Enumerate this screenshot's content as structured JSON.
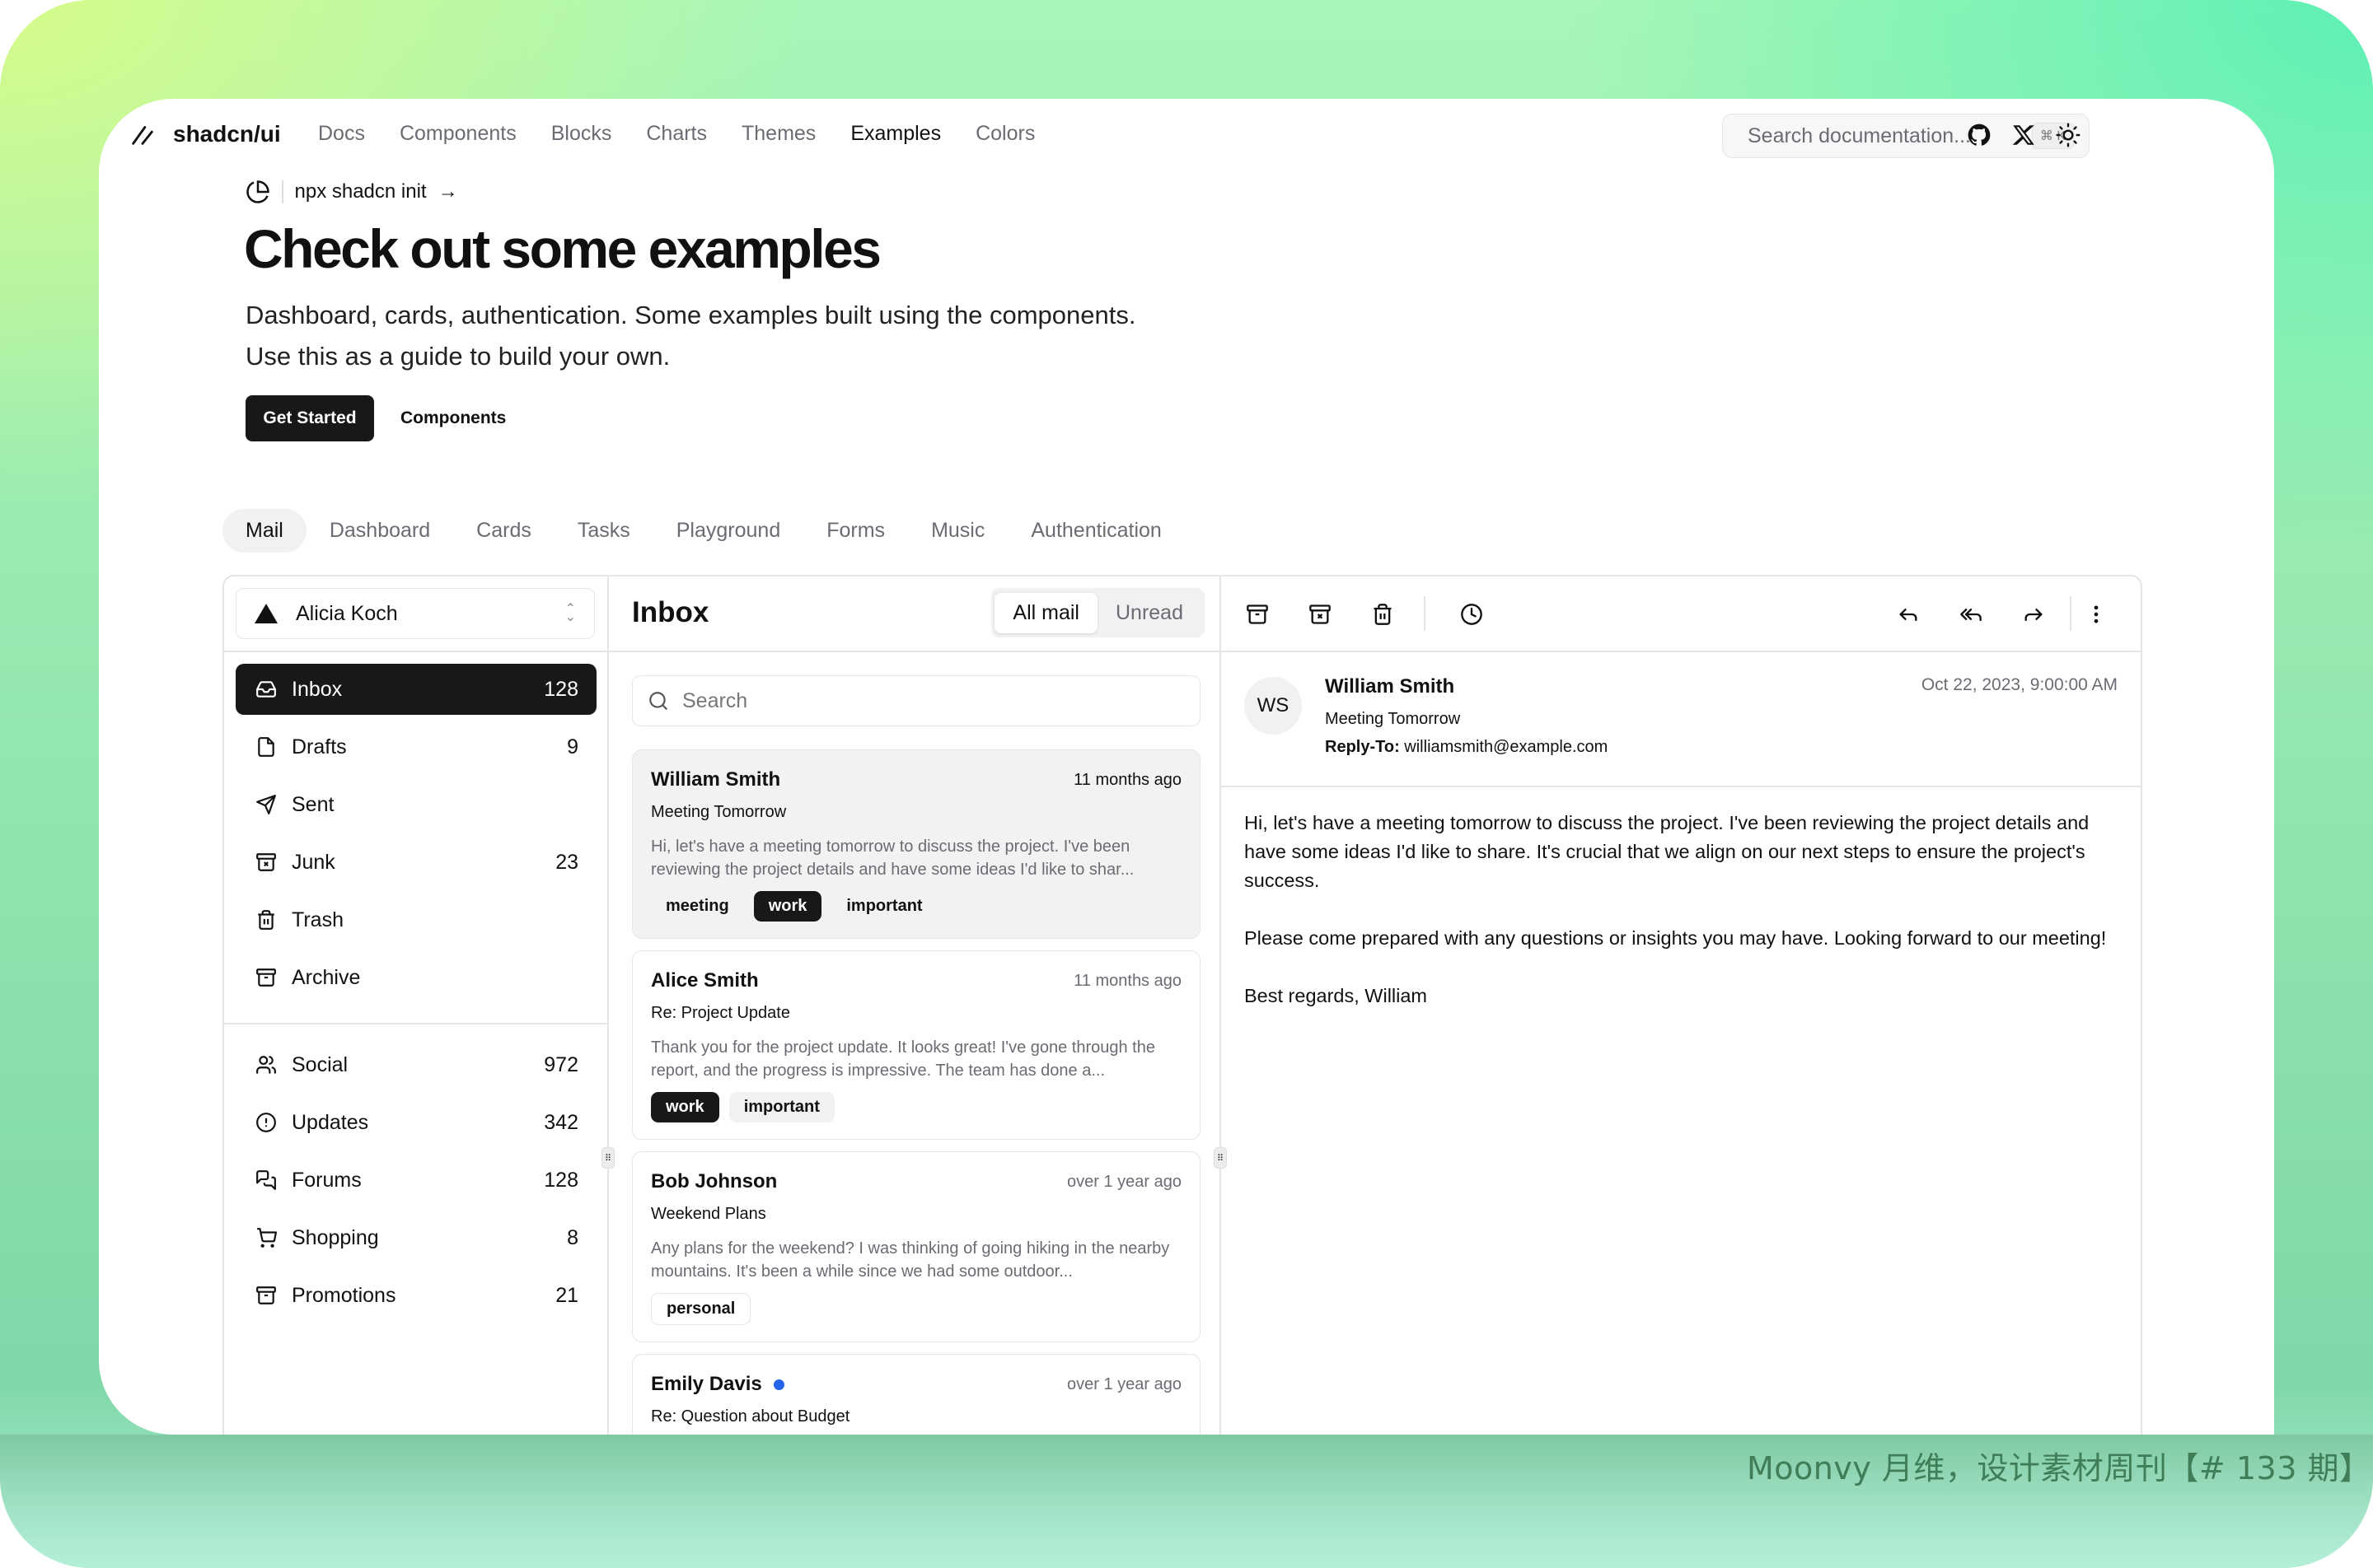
{
  "site": {
    "logo_text": "shadcn/ui",
    "nav": [
      {
        "label": "Docs",
        "active": false
      },
      {
        "label": "Components",
        "active": false
      },
      {
        "label": "Blocks",
        "active": false
      },
      {
        "label": "Charts",
        "active": false
      },
      {
        "label": "Themes",
        "active": false
      },
      {
        "label": "Examples",
        "active": true
      },
      {
        "label": "Colors",
        "active": false
      }
    ],
    "search_placeholder": "Search documentation...",
    "search_shortcut": "⌘ K",
    "icons": [
      "github-icon",
      "x-icon",
      "sun-icon"
    ]
  },
  "hero": {
    "announcement": "npx shadcn init",
    "announcement_arrow": "→",
    "title": "Check out some examples",
    "subtitle_line1": "Dashboard, cards, authentication. Some examples built using the components.",
    "subtitle_line2": "Use this as a guide to build your own.",
    "primary_button": "Get Started",
    "secondary_button": "Components"
  },
  "example_tabs": [
    {
      "label": "Mail",
      "active": true
    },
    {
      "label": "Dashboard",
      "active": false
    },
    {
      "label": "Cards",
      "active": false
    },
    {
      "label": "Tasks",
      "active": false
    },
    {
      "label": "Playground",
      "active": false
    },
    {
      "label": "Forms",
      "active": false
    },
    {
      "label": "Music",
      "active": false
    },
    {
      "label": "Authentication",
      "active": false
    }
  ],
  "mail": {
    "account": "Alicia Koch",
    "folders_primary": [
      {
        "label": "Inbox",
        "count": "128",
        "icon": "inbox-icon",
        "active": true
      },
      {
        "label": "Drafts",
        "count": "9",
        "icon": "file-icon",
        "active": false
      },
      {
        "label": "Sent",
        "count": "",
        "icon": "send-icon",
        "active": false
      },
      {
        "label": "Junk",
        "count": "23",
        "icon": "archive-x-icon",
        "active": false
      },
      {
        "label": "Trash",
        "count": "",
        "icon": "trash-icon",
        "active": false
      },
      {
        "label": "Archive",
        "count": "",
        "icon": "archive-icon",
        "active": false
      }
    ],
    "folders_secondary": [
      {
        "label": "Social",
        "count": "972",
        "icon": "users-icon"
      },
      {
        "label": "Updates",
        "count": "342",
        "icon": "alert-circle-icon"
      },
      {
        "label": "Forums",
        "count": "128",
        "icon": "messages-icon"
      },
      {
        "label": "Shopping",
        "count": "8",
        "icon": "cart-icon"
      },
      {
        "label": "Promotions",
        "count": "21",
        "icon": "archive-icon"
      }
    ],
    "list": {
      "title": "Inbox",
      "filters": [
        {
          "label": "All mail",
          "active": true
        },
        {
          "label": "Unread",
          "active": false
        }
      ],
      "search_placeholder": "Search",
      "items": [
        {
          "name": "William Smith",
          "unread": false,
          "date": "11 months ago",
          "subject": "Meeting Tomorrow",
          "preview": "Hi, let's have a meeting tomorrow to discuss the project. I've been reviewing the project details and have some ideas I'd like to shar...",
          "selected": true,
          "tags": [
            {
              "label": "meeting",
              "style": "plain"
            },
            {
              "label": "work",
              "style": "dark"
            },
            {
              "label": "important",
              "style": "plain"
            }
          ]
        },
        {
          "name": "Alice Smith",
          "unread": false,
          "date": "11 months ago",
          "subject": "Re: Project Update",
          "preview": "Thank you for the project update. It looks great! I've gone through the report, and the progress is impressive. The team has done a...",
          "selected": false,
          "tags": [
            {
              "label": "work",
              "style": "dark"
            },
            {
              "label": "important",
              "style": "soft"
            }
          ]
        },
        {
          "name": "Bob Johnson",
          "unread": false,
          "date": "over 1 year ago",
          "subject": "Weekend Plans",
          "preview": "Any plans for the weekend? I was thinking of going hiking in the nearby mountains. It's been a while since we had some outdoor...",
          "selected": false,
          "tags": [
            {
              "label": "personal",
              "style": "outline"
            }
          ]
        },
        {
          "name": "Emily Davis",
          "unread": true,
          "date": "over 1 year ago",
          "subject": "Re: Question about Budget",
          "preview": "",
          "selected": false,
          "tags": []
        }
      ]
    },
    "detail": {
      "toolbar_left": [
        "archive-icon",
        "archive-x-icon",
        "trash-icon",
        "clock-icon"
      ],
      "toolbar_right": [
        "reply-icon",
        "reply-all-icon",
        "forward-icon",
        "more-vertical-icon"
      ],
      "initials": "WS",
      "from": "William Smith",
      "subject": "Meeting Tomorrow",
      "reply_to_label": "Reply-To:",
      "reply_to": "williamsmith@example.com",
      "date": "Oct 22, 2023, 9:00:00 AM",
      "body": [
        "Hi, let's have a meeting tomorrow to discuss the project. I've been reviewing the project details and have some ideas I'd like to share. It's crucial that we align on our next steps to ensure the project's success.",
        "Please come prepared with any questions or insights you may have. Looking forward to our meeting!",
        "Best regards, William"
      ]
    }
  },
  "watermark": "Moonvy 月维，设计素材周刊【# 133 期】",
  "colors": {
    "primary": "#18181b",
    "muted_text": "#6b6b73",
    "border": "#e5e5e7",
    "unread_dot": "#2563eb",
    "bg_lime": "#d6fb8a",
    "bg_mint": "#5ef0b4"
  }
}
